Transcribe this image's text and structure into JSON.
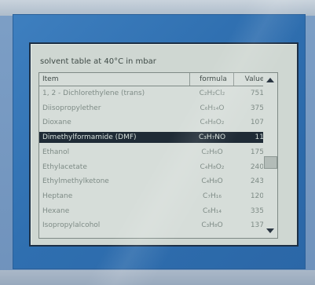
{
  "title": "solvent table at 40°C in mbar",
  "columns": [
    "Item",
    "formula",
    "Value"
  ],
  "rows": [
    {
      "name": "1, 2 - Dichlorethylene (trans)",
      "formula": "C₂H₂Cl₂",
      "value": "751"
    },
    {
      "name": "Diisopropylether",
      "formula": "C₆H₁₄O",
      "value": "375"
    },
    {
      "name": "Dioxane",
      "formula": "C₄H₈O₂",
      "value": "107"
    },
    {
      "name": "Dimethylformamide (DMF)",
      "formula": "C₃H₇NO",
      "value": "11"
    },
    {
      "name": "Ethanol",
      "formula": "C₂H₆O",
      "value": "175"
    },
    {
      "name": "Ethylacetate",
      "formula": "C₄H₈O₂",
      "value": "240"
    },
    {
      "name": "Ethylmethylketone",
      "formula": "C₄H₈O",
      "value": "243"
    },
    {
      "name": "Heptane",
      "formula": "C₇H₁₆",
      "value": "120"
    },
    {
      "name": "Hexane",
      "formula": "C₆H₁₄",
      "value": "335"
    },
    {
      "name": "Isopropylalcohol",
      "formula": "C₃H₈O",
      "value": "137"
    }
  ],
  "selected_row": 3,
  "colors": {
    "frame": "#3e7fbf",
    "screen": "#cfd7d2",
    "selection": "#1f2b36"
  }
}
